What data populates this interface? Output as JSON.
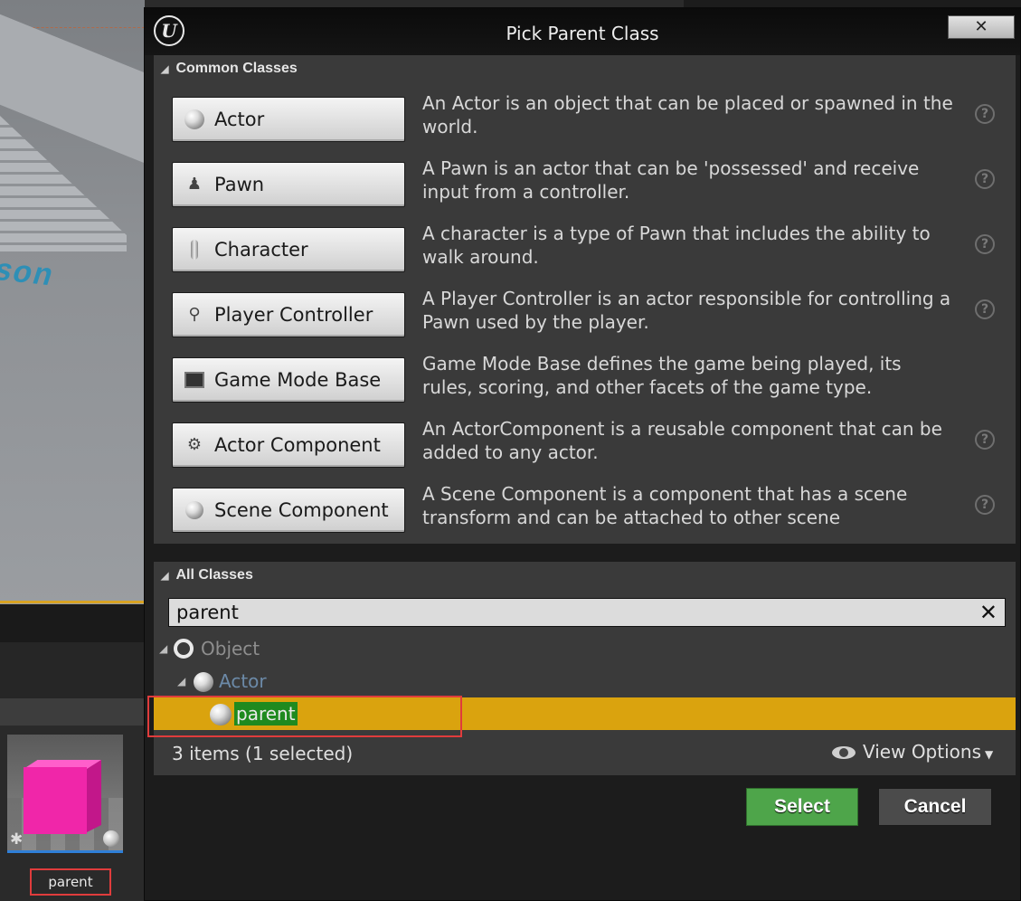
{
  "window": {
    "title": "Pick Parent Class",
    "close_glyph": "✕",
    "logo_glyph": "U"
  },
  "common_classes": {
    "header": "Common Classes",
    "items": [
      {
        "label": "Actor",
        "icon": "actor-sphere-icon",
        "description": "An Actor is an object that can be placed or spawned in the world."
      },
      {
        "label": "Pawn",
        "icon": "pawn-icon",
        "description": "A Pawn is an actor that can be 'possessed' and receive input from a controller."
      },
      {
        "label": "Character",
        "icon": "character-icon",
        "description": "A character is a type of Pawn that includes the ability to walk around."
      },
      {
        "label": "Player Controller",
        "icon": "player-controller-icon",
        "description": "A Player Controller is an actor responsible for controlling a Pawn used by the player."
      },
      {
        "label": "Game Mode Base",
        "icon": "game-mode-icon",
        "description": "Game Mode Base defines the game being played, its rules, scoring, and other facets of the game type."
      },
      {
        "label": "Actor Component",
        "icon": "actor-component-icon",
        "description": "An ActorComponent is a reusable component that can be added to any actor."
      },
      {
        "label": "Scene Component",
        "icon": "scene-component-icon",
        "description": "A Scene Component is a component that has a scene transform and can be attached to other scene"
      }
    ]
  },
  "all_classes": {
    "header": "All Classes",
    "search_value": "parent",
    "clear_glyph": "✕",
    "tree": {
      "root": "Object",
      "child": "Actor",
      "selected": "parent"
    },
    "count": "3 items (1 selected)",
    "view_options": "View Options"
  },
  "buttons": {
    "select": "Select",
    "cancel": "Cancel"
  },
  "content_browser": {
    "asset_label": "parent"
  },
  "viewport": {
    "floor_text": "son"
  },
  "colors": {
    "selected_row": "#daa30e",
    "select_button": "#4ea54a",
    "highlight": "#e03c3c"
  }
}
